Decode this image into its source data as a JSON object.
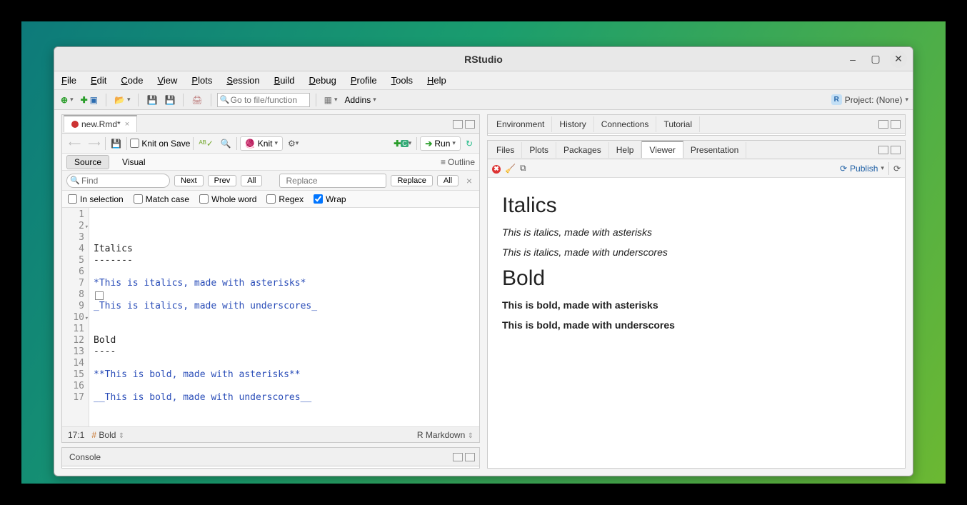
{
  "window": {
    "title": "RStudio"
  },
  "menus": [
    "File",
    "Edit",
    "Code",
    "View",
    "Plots",
    "Session",
    "Build",
    "Debug",
    "Profile",
    "Tools",
    "Help"
  ],
  "toolbar": {
    "goto_placeholder": "Go to file/function",
    "addins": "Addins",
    "project_label": "Project: (None)"
  },
  "source": {
    "filetab": "new.Rmd*",
    "knit_on_save": "Knit on Save",
    "knit": "Knit",
    "run": "Run",
    "modes": {
      "source": "Source",
      "visual": "Visual"
    },
    "outline": "Outline",
    "find": {
      "find_ph": "Find",
      "replace_ph": "Replace",
      "next": "Next",
      "prev": "Prev",
      "all": "All",
      "replace_btn": "Replace",
      "all2": "All",
      "opts": {
        "in_selection": "In selection",
        "match_case": "Match case",
        "whole_word": "Whole word",
        "regex": "Regex",
        "wrap": "Wrap"
      }
    },
    "lines": [
      {
        "n": 1,
        "cls": "black",
        "text": "Italics"
      },
      {
        "n": 2,
        "cls": "black",
        "text": "-------",
        "fold": true
      },
      {
        "n": 3,
        "cls": "black",
        "text": ""
      },
      {
        "n": 4,
        "cls": "blue",
        "text": "*This is italics, made with asterisks*"
      },
      {
        "n": 5,
        "cls": "black",
        "text": ""
      },
      {
        "n": 6,
        "cls": "blue",
        "text": "_This is italics, made with underscores_"
      },
      {
        "n": 7,
        "cls": "black",
        "text": ""
      },
      {
        "n": 8,
        "cls": "black",
        "text": ""
      },
      {
        "n": 9,
        "cls": "black",
        "text": "Bold"
      },
      {
        "n": 10,
        "cls": "black",
        "text": "----",
        "fold": true
      },
      {
        "n": 11,
        "cls": "black",
        "text": ""
      },
      {
        "n": 12,
        "cls": "blue",
        "text": "**This is bold, made with asterisks**"
      },
      {
        "n": 13,
        "cls": "black",
        "text": ""
      },
      {
        "n": 14,
        "cls": "blue",
        "text": "__This is bold, made with underscores__"
      },
      {
        "n": 15,
        "cls": "black",
        "text": ""
      },
      {
        "n": 16,
        "cls": "black",
        "text": ""
      },
      {
        "n": 17,
        "cls": "black",
        "text": ""
      }
    ],
    "status": {
      "pos": "17:1",
      "section": "Bold",
      "lang": "R Markdown"
    }
  },
  "console": {
    "label": "Console"
  },
  "env_tabs": [
    "Environment",
    "History",
    "Connections",
    "Tutorial"
  ],
  "viewer_tabs": [
    "Files",
    "Plots",
    "Packages",
    "Help",
    "Viewer",
    "Presentation"
  ],
  "viewer_toolbar": {
    "publish": "Publish"
  },
  "preview": {
    "h_italics": "Italics",
    "p_italics_ast": "This is italics, made with asterisks",
    "p_italics_und": "This is italics, made with underscores",
    "h_bold": "Bold",
    "p_bold_ast": "This is bold, made with asterisks",
    "p_bold_und": "This is bold, made with underscores"
  }
}
